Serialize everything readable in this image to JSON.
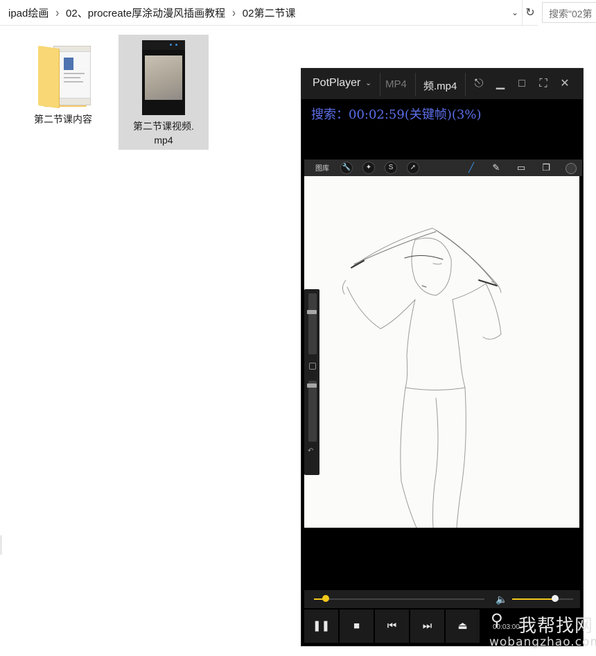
{
  "explorer": {
    "breadcrumbs": [
      "ipad绘画",
      "02、procreate厚涂动漫风插画教程",
      "02第二节课"
    ],
    "search_placeholder": "搜索\"02第"
  },
  "files": [
    {
      "name": "第二节课内容",
      "type": "folder",
      "selected": false
    },
    {
      "name_line1": "第二节课视频.",
      "name_line2": "mp4",
      "type": "video",
      "selected": true
    }
  ],
  "player": {
    "brand": "PotPlayer",
    "format_tab": "MP4",
    "file_tab": "频.mp4",
    "seek_message": "搜索：00:02:59(关键帧)(3%)",
    "time": "00:03:00",
    "seek_progress": 0.07,
    "volume": 0.7
  },
  "procreate": {
    "gallery_label": "图库"
  },
  "watermark": {
    "cn": "我帮找网",
    "en": "wobangzhao.com"
  }
}
